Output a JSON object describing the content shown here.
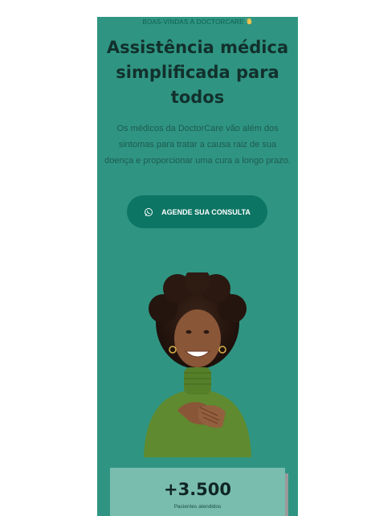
{
  "hero": {
    "welcome_text": "BOAS-VINDAS À DOCTORCARE",
    "welcome_icon": "waving-hand-icon",
    "headline": "Assistência médica simplificada para todos",
    "description": "Os médicos da DoctorCare vão além dos sintomas para tratar a causa raiz de sua doença e proporcionar uma cura a longo prazo.",
    "cta": {
      "label": "AGENDE SUA CONSULTA",
      "icon": "whatsapp-icon"
    }
  },
  "stats": {
    "value": "+3.500",
    "label": "Pacientes atendidos"
  },
  "colors": {
    "panel": "#2f9582",
    "button": "#0d7564",
    "stat_card": "#79bdaf",
    "headline": "#12302c"
  }
}
